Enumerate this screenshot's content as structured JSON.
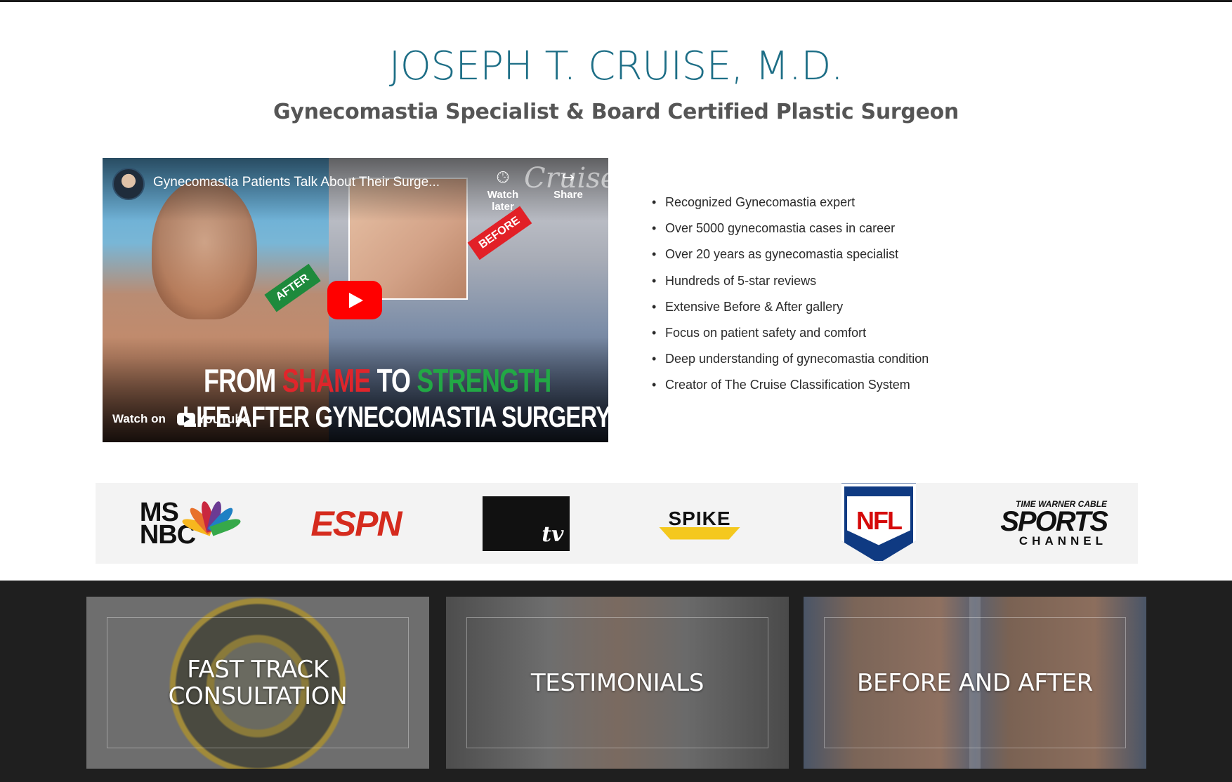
{
  "hero": {
    "title": "JOSEPH T. CRUISE, M.D.",
    "subtitle": "Gynecomastia Specialist & Board Certified Plastic Surgeon"
  },
  "video": {
    "title": "Gynecomastia Patients Talk About Their Surge...",
    "watch_later": "Watch later",
    "share": "Share",
    "watermark": "Cruise",
    "tag_after": "AFTER",
    "tag_before": "BEFORE",
    "headline_from": "FROM ",
    "headline_shame": "SHAME",
    "headline_to": " TO ",
    "headline_strength": "STRENGTH",
    "headline_line2": "LIFE AFTER GYNECOMASTIA SURGERY",
    "watch_on": "Watch on",
    "youtube": "YouTube"
  },
  "highlights": [
    "Recognized Gynecomastia expert",
    "Over 5000 gynecomastia cases in career",
    "Over 20 years as gynecomastia specialist",
    "Hundreds of 5-star reviews",
    "Extensive Before & After gallery",
    "Focus on patient safety and comfort",
    "Deep understanding of gynecomastia condition",
    "Creator of The Cruise Classification System"
  ],
  "media_logos": {
    "msnbc": "MS\nNBC",
    "espn": "ESPN",
    "mtv": "tv",
    "spike": "SPIKE",
    "nfl": "NFL",
    "twc_line1": "TIME WARNER CABLE",
    "twc_line2": "SPORTS",
    "twc_line3": "CHANNEL"
  },
  "cta_tiles": [
    {
      "label": "FAST TRACK CONSULTATION"
    },
    {
      "label": "TESTIMONIALS"
    },
    {
      "label": "BEFORE AND AFTER"
    }
  ],
  "colors": {
    "title": "#1d6e86",
    "band": "#1f1f1f",
    "youtube_red": "#ff0000"
  }
}
